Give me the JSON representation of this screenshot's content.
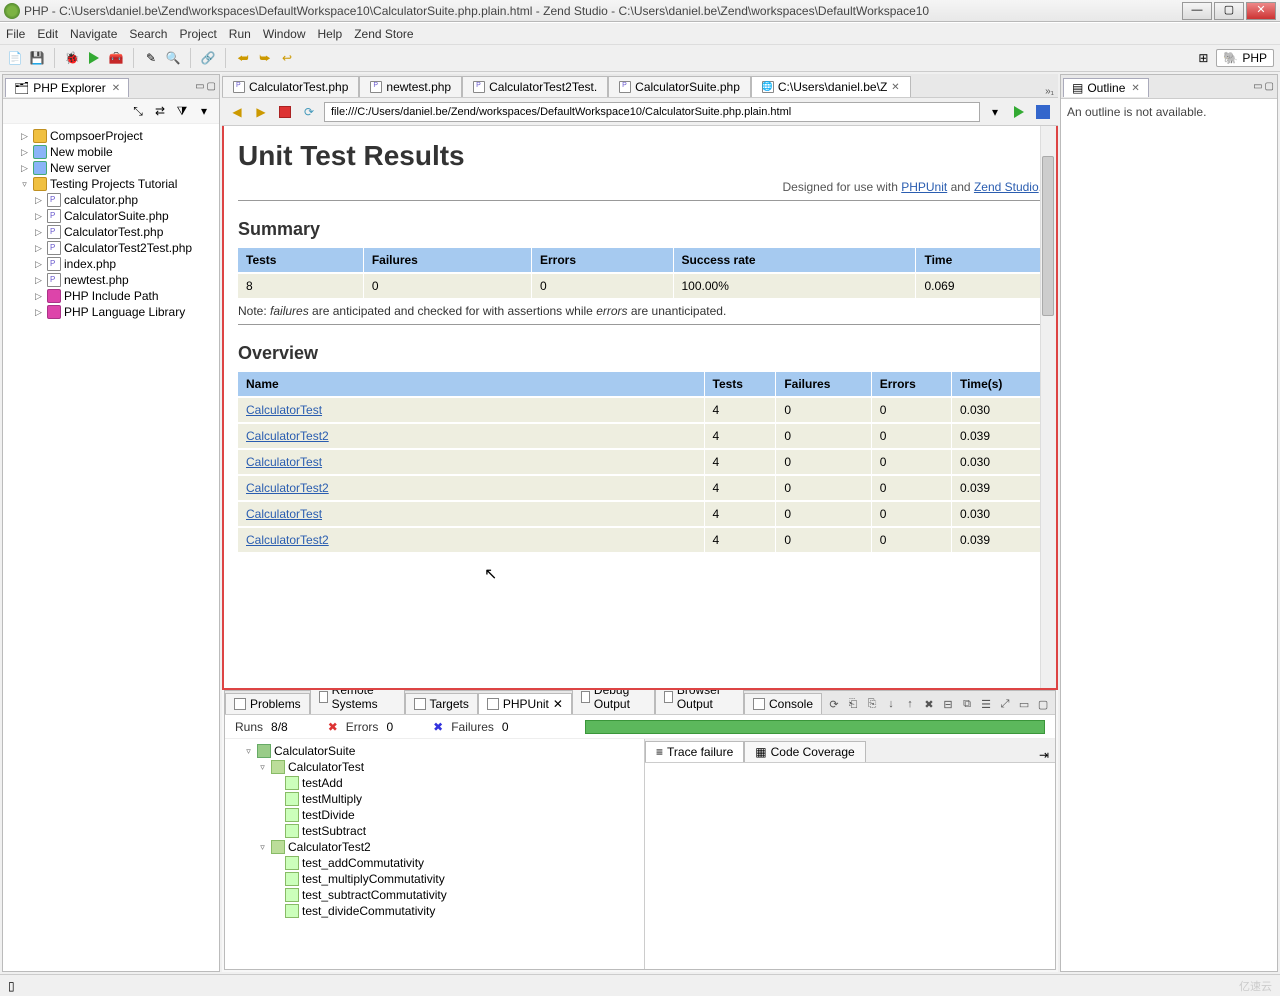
{
  "window": {
    "title": "PHP - C:\\Users\\daniel.be\\Zend\\workspaces\\DefaultWorkspace10\\CalculatorSuite.php.plain.html - Zend Studio - C:\\Users\\daniel.be\\Zend\\workspaces\\DefaultWorkspace10"
  },
  "menu": [
    "File",
    "Edit",
    "Navigate",
    "Search",
    "Project",
    "Run",
    "Window",
    "Help",
    "Zend Store"
  ],
  "perspective": "PHP",
  "explorer": {
    "title": "PHP Explorer",
    "items": [
      {
        "l": 1,
        "exp": "▷",
        "icon": "proj",
        "label": "CompsoerProject"
      },
      {
        "l": 1,
        "exp": "▷",
        "icon": "srv",
        "label": "New mobile"
      },
      {
        "l": 1,
        "exp": "▷",
        "icon": "srv",
        "label": "New server"
      },
      {
        "l": 1,
        "exp": "▿",
        "icon": "proj",
        "label": "Testing Projects Tutorial"
      },
      {
        "l": 2,
        "exp": "▷",
        "icon": "file",
        "label": "calculator.php"
      },
      {
        "l": 2,
        "exp": "▷",
        "icon": "file",
        "label": "CalculatorSuite.php"
      },
      {
        "l": 2,
        "exp": "▷",
        "icon": "file",
        "label": "CalculatorTest.php"
      },
      {
        "l": 2,
        "exp": "▷",
        "icon": "file",
        "label": "CalculatorTest2Test.php"
      },
      {
        "l": 2,
        "exp": "▷",
        "icon": "file",
        "label": "index.php"
      },
      {
        "l": 2,
        "exp": "▷",
        "icon": "file",
        "label": "newtest.php"
      },
      {
        "l": 2,
        "exp": "▷",
        "icon": "lib",
        "label": "PHP Include Path"
      },
      {
        "l": 2,
        "exp": "▷",
        "icon": "lib",
        "label": "PHP Language Library"
      }
    ]
  },
  "editor_tabs": [
    {
      "label": "CalculatorTest.php",
      "iconcls": "fic"
    },
    {
      "label": "newtest.php",
      "iconcls": "fic"
    },
    {
      "label": "CalculatorTest2Test.",
      "iconcls": "fic"
    },
    {
      "label": "CalculatorSuite.php",
      "iconcls": "fic"
    },
    {
      "label": "C:\\Users\\daniel.be\\Z",
      "iconcls": "fic br",
      "active": true,
      "close": true
    }
  ],
  "editor_overflow": "»₁",
  "address": "file:///C:/Users/daniel.be/Zend/workspaces/DefaultWorkspace10/CalculatorSuite.php.plain.html",
  "report": {
    "title": "Unit Test Results",
    "subhead_pre": "Designed for use with ",
    "link1": "PHPUnit",
    "subhead_mid": " and ",
    "link2": "Zend Studio",
    "summary_h": "Summary",
    "summary_headers": [
      "Tests",
      "Failures",
      "Errors",
      "Success rate",
      "Time"
    ],
    "summary_row": [
      "8",
      "0",
      "0",
      "100.00%",
      "0.069"
    ],
    "note_pre": "Note: ",
    "note_i1": "failures",
    "note_mid": " are anticipated and checked for with assertions while ",
    "note_i2": "errors",
    "note_post": " are unanticipated.",
    "overview_h": "Overview",
    "ov_headers": [
      "Name",
      "Tests",
      "Failures",
      "Errors",
      "Time(s)"
    ],
    "ov_rows": [
      [
        "CalculatorTest",
        "4",
        "0",
        "0",
        "0.030"
      ],
      [
        "CalculatorTest2",
        "4",
        "0",
        "0",
        "0.039"
      ],
      [
        "CalculatorTest",
        "4",
        "0",
        "0",
        "0.030"
      ],
      [
        "CalculatorTest2",
        "4",
        "0",
        "0",
        "0.039"
      ],
      [
        "CalculatorTest",
        "4",
        "0",
        "0",
        "0.030"
      ],
      [
        "CalculatorTest2",
        "4",
        "0",
        "0",
        "0.039"
      ]
    ]
  },
  "outline": {
    "title": "Outline",
    "msg": "An outline is not available."
  },
  "bottom_tabs": [
    "Problems",
    "Remote Systems",
    "Targets",
    "PHPUnit",
    "Debug Output",
    "Browser Output",
    "Console"
  ],
  "bottom_active": 3,
  "runs": {
    "runs_lbl": "Runs",
    "runs_val": "8/8",
    "err_lbl": "Errors",
    "err_val": "0",
    "fail_lbl": "Failures",
    "fail_val": "0"
  },
  "test_tree": [
    {
      "l": 1,
      "exp": "▿",
      "icon": "suite",
      "label": "CalculatorSuite"
    },
    {
      "l": 2,
      "exp": "▿",
      "icon": "tclass",
      "label": "CalculatorTest"
    },
    {
      "l": 3,
      "exp": "",
      "icon": "tmethod",
      "label": "testAdd"
    },
    {
      "l": 3,
      "exp": "",
      "icon": "tmethod",
      "label": "testMultiply"
    },
    {
      "l": 3,
      "exp": "",
      "icon": "tmethod",
      "label": "testDivide"
    },
    {
      "l": 3,
      "exp": "",
      "icon": "tmethod",
      "label": "testSubtract"
    },
    {
      "l": 2,
      "exp": "▿",
      "icon": "tclass",
      "label": "CalculatorTest2"
    },
    {
      "l": 3,
      "exp": "",
      "icon": "tmethod",
      "label": "test_addCommutativity"
    },
    {
      "l": 3,
      "exp": "",
      "icon": "tmethod",
      "label": "test_multiplyCommutativity"
    },
    {
      "l": 3,
      "exp": "",
      "icon": "tmethod",
      "label": "test_subtractCommutativity"
    },
    {
      "l": 3,
      "exp": "",
      "icon": "tmethod",
      "label": "test_divideCommutativity"
    }
  ],
  "detail_tabs": [
    "Trace failure",
    "Code Coverage"
  ],
  "watermark": "亿速云"
}
